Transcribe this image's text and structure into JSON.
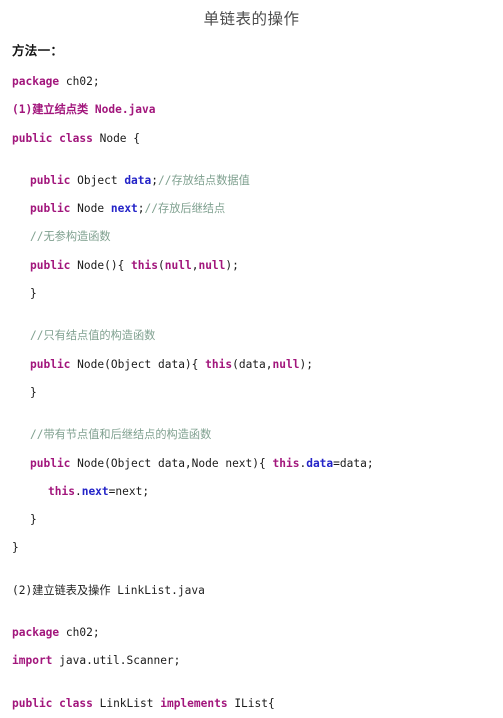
{
  "document": {
    "title": "单链表的操作",
    "section_heading": "方法一：",
    "colors": {
      "keyword": "#a2167c",
      "field": "#2424c8",
      "comment": "#7fa08f",
      "plain": "#1a1a1a",
      "title": "#4d4d4d",
      "background": "#ffffff"
    }
  },
  "code": {
    "lines": [
      {
        "id": "l01",
        "indent": 0,
        "tokens": [
          {
            "t": "package",
            "c": "kw"
          },
          {
            "t": " ch02;",
            "c": "pln"
          }
        ]
      },
      {
        "id": "l02",
        "indent": 0,
        "tokens": [
          {
            "t": "(1)建立结点类",
            "c": "hdr-magenta"
          },
          {
            "t": " Node.java",
            "c": "hdr-magenta"
          }
        ]
      },
      {
        "id": "l03",
        "indent": 0,
        "tokens": [
          {
            "t": "public",
            "c": "kw"
          },
          {
            "t": " ",
            "c": "pln"
          },
          {
            "t": "class",
            "c": "kw"
          },
          {
            "t": " Node {",
            "c": "pln"
          }
        ]
      },
      {
        "id": "l04",
        "indent": 0,
        "tokens": [
          {
            "t": "",
            "c": "pln"
          }
        ]
      },
      {
        "id": "l05",
        "indent": 1,
        "tokens": [
          {
            "t": "public",
            "c": "kw"
          },
          {
            "t": " Object ",
            "c": "pln"
          },
          {
            "t": "data",
            "c": "fld"
          },
          {
            "t": ";",
            "c": "pln"
          },
          {
            "t": "//存放结点数据值",
            "c": "cmt"
          }
        ]
      },
      {
        "id": "l06",
        "indent": 1,
        "tokens": [
          {
            "t": "public",
            "c": "kw"
          },
          {
            "t": " Node ",
            "c": "pln"
          },
          {
            "t": "next",
            "c": "fld"
          },
          {
            "t": ";",
            "c": "pln"
          },
          {
            "t": "//存放后继结点",
            "c": "cmt"
          }
        ]
      },
      {
        "id": "l07",
        "indent": 1,
        "tokens": [
          {
            "t": "//无参构造函数",
            "c": "cmt"
          }
        ]
      },
      {
        "id": "l08",
        "indent": 1,
        "tokens": [
          {
            "t": "public",
            "c": "kw"
          },
          {
            "t": " Node(){ ",
            "c": "pln"
          },
          {
            "t": "this",
            "c": "kw"
          },
          {
            "t": "(",
            "c": "pln"
          },
          {
            "t": "null",
            "c": "kw"
          },
          {
            "t": ",",
            "c": "pln"
          },
          {
            "t": "null",
            "c": "kw"
          },
          {
            "t": ");",
            "c": "pln"
          }
        ]
      },
      {
        "id": "l09",
        "indent": 1,
        "tokens": [
          {
            "t": "}",
            "c": "pln"
          }
        ]
      },
      {
        "id": "l10",
        "indent": 0,
        "tokens": [
          {
            "t": "",
            "c": "pln"
          }
        ]
      },
      {
        "id": "l11",
        "indent": 1,
        "tokens": [
          {
            "t": "//只有结点值的构造函数",
            "c": "cmt"
          }
        ]
      },
      {
        "id": "l12",
        "indent": 1,
        "tokens": [
          {
            "t": "public",
            "c": "kw"
          },
          {
            "t": " Node(Object data){ ",
            "c": "pln"
          },
          {
            "t": "this",
            "c": "kw"
          },
          {
            "t": "(data,",
            "c": "pln"
          },
          {
            "t": "null",
            "c": "kw"
          },
          {
            "t": ");",
            "c": "pln"
          }
        ]
      },
      {
        "id": "l13",
        "indent": 1,
        "tokens": [
          {
            "t": "}",
            "c": "pln"
          }
        ]
      },
      {
        "id": "l14",
        "indent": 0,
        "tokens": [
          {
            "t": "",
            "c": "pln"
          }
        ]
      },
      {
        "id": "l15",
        "indent": 1,
        "tokens": [
          {
            "t": "//带有节点值和后继结点的构造函数",
            "c": "cmt"
          }
        ]
      },
      {
        "id": "l16",
        "indent": 1,
        "tokens": [
          {
            "t": "public",
            "c": "kw"
          },
          {
            "t": " Node(Object data,Node next){ ",
            "c": "pln"
          },
          {
            "t": "this",
            "c": "kw"
          },
          {
            "t": ".",
            "c": "pln"
          },
          {
            "t": "data",
            "c": "fld"
          },
          {
            "t": "=data;",
            "c": "pln"
          }
        ]
      },
      {
        "id": "l17",
        "indent": 2,
        "tokens": [
          {
            "t": "this",
            "c": "kw"
          },
          {
            "t": ".",
            "c": "pln"
          },
          {
            "t": "next",
            "c": "fld"
          },
          {
            "t": "=next;",
            "c": "pln"
          }
        ]
      },
      {
        "id": "l18",
        "indent": 1,
        "tokens": [
          {
            "t": "}",
            "c": "pln"
          }
        ]
      },
      {
        "id": "l19",
        "indent": 0,
        "tokens": [
          {
            "t": "}",
            "c": "pln"
          }
        ]
      },
      {
        "id": "l20",
        "indent": 0,
        "tokens": [
          {
            "t": "",
            "c": "pln"
          }
        ]
      },
      {
        "id": "l21",
        "indent": 0,
        "tokens": [
          {
            "t": "(2)建立链表及操作",
            "c": "hdr-plain"
          },
          {
            "t": " LinkList.java",
            "c": "hdr-plain"
          }
        ]
      },
      {
        "id": "l22",
        "indent": 0,
        "tokens": [
          {
            "t": "",
            "c": "pln"
          }
        ]
      },
      {
        "id": "l23",
        "indent": 0,
        "tokens": [
          {
            "t": "package",
            "c": "kw"
          },
          {
            "t": " ch02;",
            "c": "pln"
          }
        ]
      },
      {
        "id": "l24",
        "indent": 0,
        "tokens": [
          {
            "t": "import",
            "c": "kw"
          },
          {
            "t": " java.util.Scanner;",
            "c": "pln"
          }
        ]
      },
      {
        "id": "l25",
        "indent": 0,
        "tokens": [
          {
            "t": "",
            "c": "pln"
          }
        ]
      },
      {
        "id": "l26",
        "indent": 0,
        "tokens": [
          {
            "t": "public",
            "c": "kw"
          },
          {
            "t": " ",
            "c": "pln"
          },
          {
            "t": "class",
            "c": "kw"
          },
          {
            "t": " LinkList ",
            "c": "pln"
          },
          {
            "t": "implements",
            "c": "kw"
          },
          {
            "t": " IList{",
            "c": "pln"
          }
        ]
      }
    ]
  }
}
